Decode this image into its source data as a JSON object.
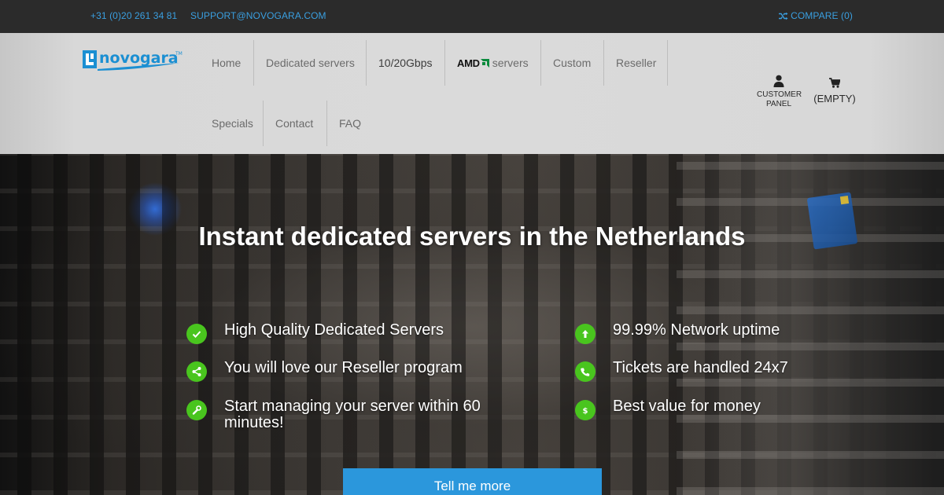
{
  "topbar": {
    "phone": "+31 (0)20 261 34 81",
    "email": "SUPPORT@NOVOGARA.COM",
    "compare": "COMPARE (0)"
  },
  "brand": {
    "name": "novogara",
    "tm": "™",
    "color": "#1b8fd2"
  },
  "nav": {
    "row1": [
      {
        "label": "Home"
      },
      {
        "label": "Dedicated servers"
      },
      {
        "label": "10/20Gbps"
      },
      {
        "label": "servers",
        "prefix_logo": "AMD"
      },
      {
        "label": "Custom"
      },
      {
        "label": "Reseller"
      }
    ],
    "row2": [
      {
        "label": "Specials"
      },
      {
        "label": "Contact"
      },
      {
        "label": "FAQ"
      }
    ]
  },
  "customer_panel": {
    "line1": "CUSTOMER",
    "line2": "PANEL",
    "icon": "user-icon"
  },
  "cart": {
    "label": "(EMPTY)",
    "icon": "cart-icon"
  },
  "hero": {
    "title": "Instant dedicated servers in the Netherlands",
    "features_left": [
      {
        "text": "High Quality Dedicated Servers",
        "icon": "check-icon"
      },
      {
        "text": "You will love our Reseller program",
        "icon": "share-icon"
      },
      {
        "text": "Start managing your server within 60 minutes!",
        "icon": "wrench-icon"
      }
    ],
    "features_right": [
      {
        "text": "99.99% Network uptime",
        "icon": "arrow-up-icon"
      },
      {
        "text": "Tickets are handled 24x7",
        "icon": "phone-icon"
      },
      {
        "text": "Best value for money",
        "icon": "dollar-icon"
      }
    ],
    "cta": "Tell me more"
  },
  "colors": {
    "accent": "#2b97dc",
    "feature_icon": "#49c51e",
    "topbar_link": "#3a9fe0"
  }
}
